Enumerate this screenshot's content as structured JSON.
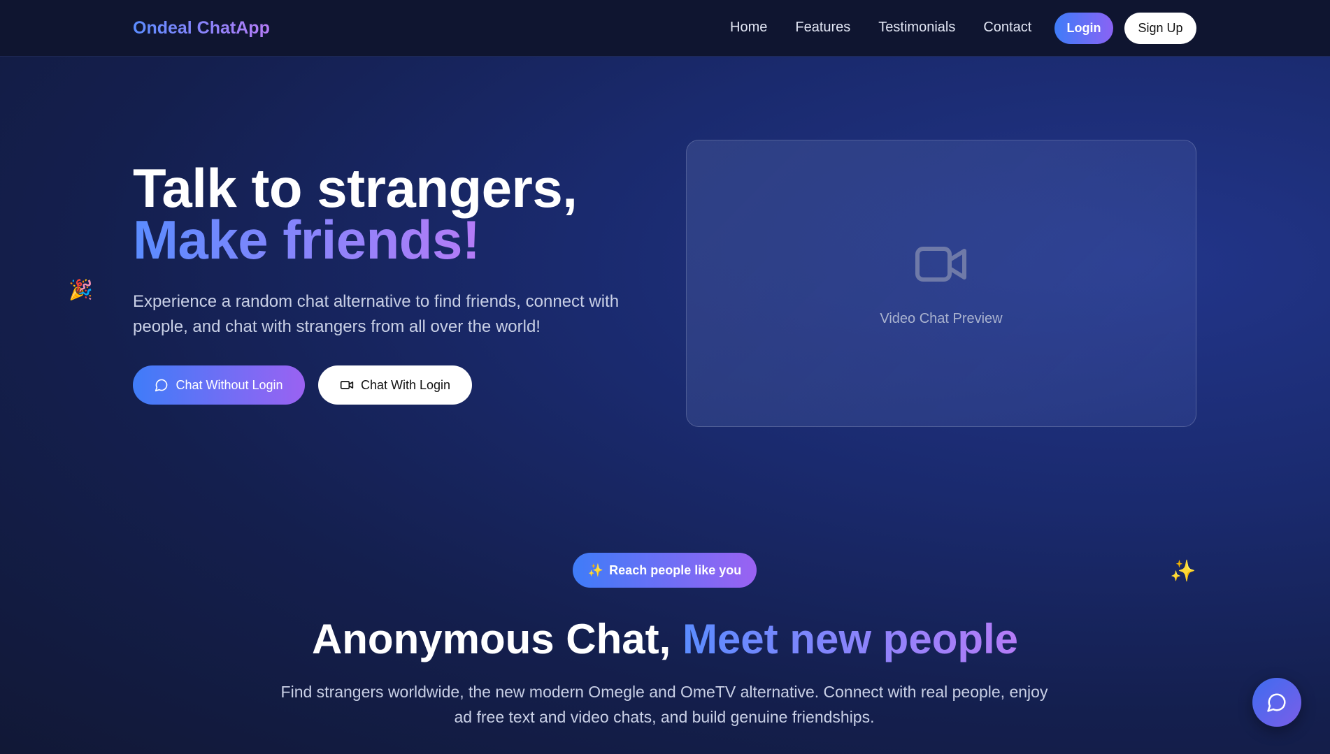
{
  "nav": {
    "brand": "Ondeal ChatApp",
    "links": [
      "Home",
      "Features",
      "Testimonials",
      "Contact"
    ],
    "login": "Login",
    "signup": "Sign Up"
  },
  "hero": {
    "title_line1": "Talk to strangers,",
    "title_line2": "Make friends!",
    "subtitle": "Experience a random chat alternative to find friends, connect with people, and chat with strangers from all over the world!",
    "btn_chat_without_login": "Chat Without Login",
    "btn_chat_with_login": "Chat With Login",
    "decor_emoji": "🎉"
  },
  "preview": {
    "icon": "video-camera-icon",
    "label": "Video Chat Preview"
  },
  "section": {
    "pill_icon": "✨",
    "pill_label": "Reach people like you",
    "title_plain": "Anonymous Chat,",
    "title_accent": "Meet new people",
    "subtitle": "Find strangers worldwide, the new modern Omegle and OmeTV alternative. Connect with real people, enjoy ad free text and video chats, and build genuine friendships.",
    "decor_emoji": "✨"
  },
  "fab": {
    "icon": "chat-bubble-icon"
  },
  "colors": {
    "accent_blue": "#3f7cf8",
    "accent_purple": "#9a62f2",
    "nav_bg": "#0f1530",
    "page_bg": "#1a2a6e"
  }
}
